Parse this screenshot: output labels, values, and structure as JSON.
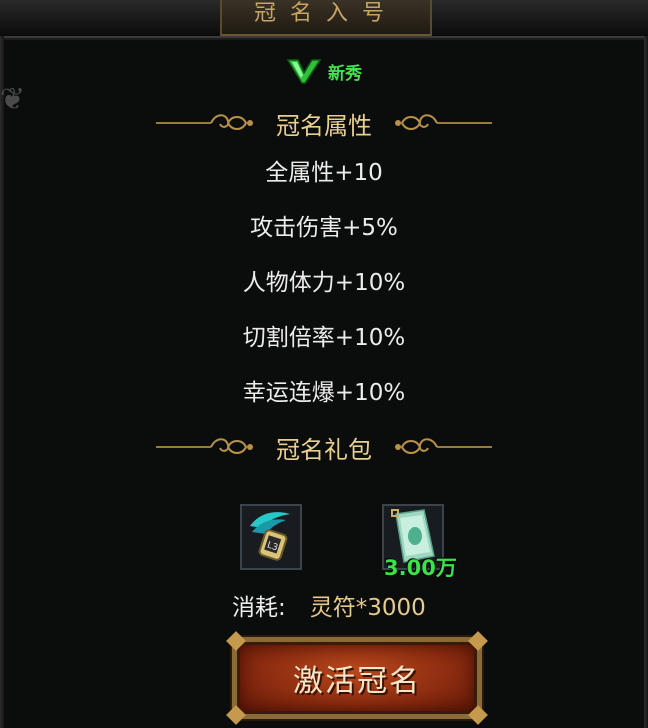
{
  "window": {
    "title": "冠名入号"
  },
  "rank": {
    "icon": "v-rank-icon",
    "name": "新秀"
  },
  "attributes_section": {
    "title": "冠名属性"
  },
  "attributes": [
    "全属性+10",
    "攻击伤害+5%",
    "人物体力+10%",
    "切割倍率+10%",
    "幸运连爆+10%"
  ],
  "gift_section": {
    "title": "冠名礼包"
  },
  "gift_items": [
    {
      "icon": "teal-badge-icon",
      "quantity": ""
    },
    {
      "icon": "banknote-icon",
      "quantity": "3.00万"
    }
  ],
  "cost": {
    "label": "消耗:",
    "value": "灵符*3000"
  },
  "activate_button": {
    "label": "激活冠名"
  },
  "colors": {
    "background": "#0b0d0c",
    "section_title": "#e9cf8f",
    "attribute_text": "#ececea",
    "rank_green": "#43e24f",
    "button_red": "#8c2c10",
    "button_border": "#8a6a36"
  }
}
